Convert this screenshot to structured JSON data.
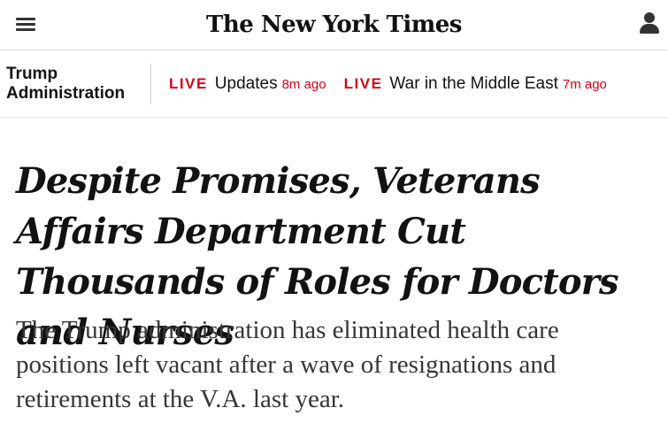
{
  "header": {
    "logo": "The New York Times",
    "menu_icon": "hamburger-menu-icon",
    "account_icon": "user-account-icon"
  },
  "subnav": {
    "section": "Trump Administration",
    "live_items": [
      {
        "tag": "LIVE",
        "title": "Updates",
        "time": "8m ago"
      },
      {
        "tag": "LIVE",
        "title": "War in the Middle East",
        "time": "7m ago"
      }
    ]
  },
  "article": {
    "headline": "Despite Promises, Veterans Affairs Department Cut Thousands of Roles for Doctors and Nurses",
    "summary": "The Trump administration has eliminated health care positions left vacant after a wave of resignations and retirements at the V.A. last year."
  },
  "colors": {
    "live_red": "#d0021b",
    "text": "#121212",
    "summary_text": "#363636"
  }
}
